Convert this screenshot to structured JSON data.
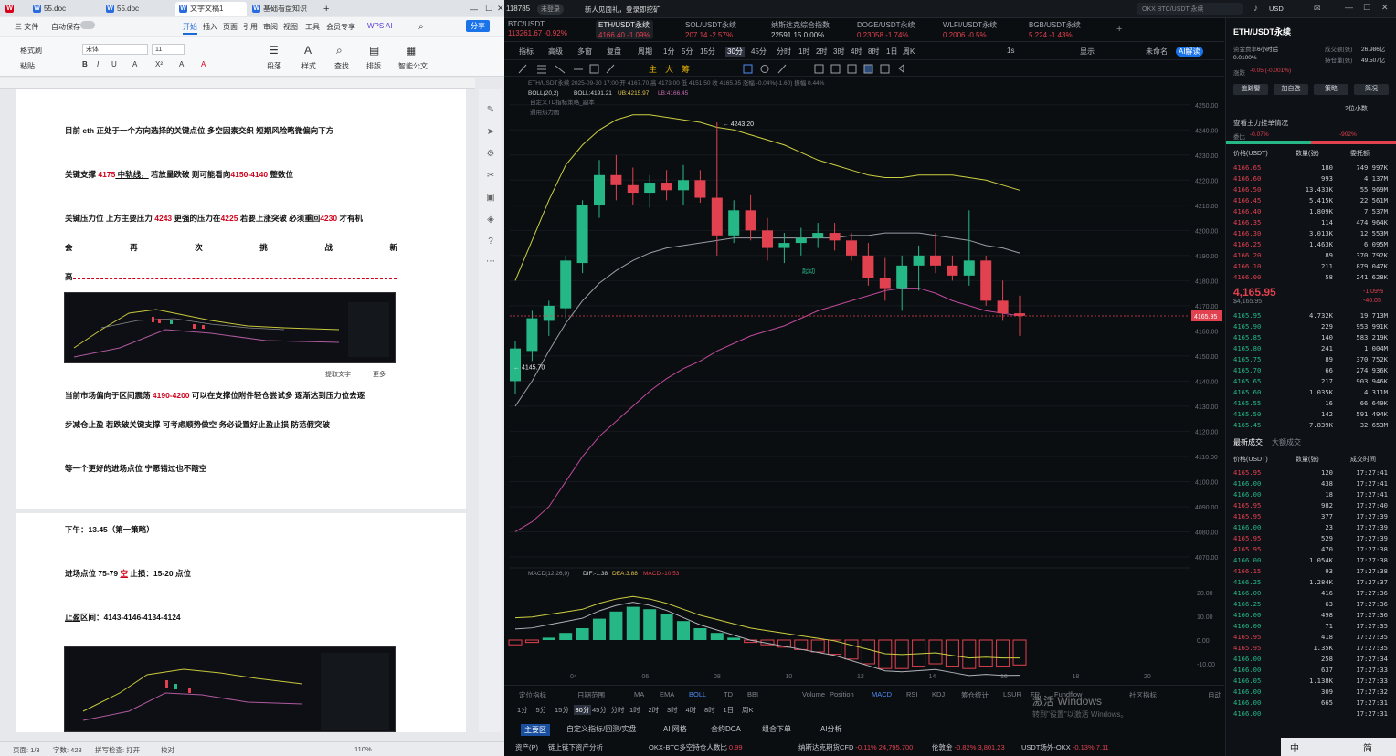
{
  "wps": {
    "tabs": [
      {
        "label": "WPS",
        "icon": "wps-logo-icon",
        "color": "#d9001b"
      },
      {
        "label": "55.doc",
        "icon": "doc-icon",
        "color": "#2b6be0"
      },
      {
        "label": "55.doc",
        "icon": "doc-icon",
        "color": "#2b6be0"
      },
      {
        "label": "文字文稿1",
        "icon": "doc-icon",
        "color": "#2b6be0"
      },
      {
        "label": "基础看盘知识",
        "icon": "doc-icon",
        "color": "#2b6be0"
      }
    ],
    "menu": [
      "三 文件",
      "自动保存",
      "开始",
      "插入",
      "页面",
      "引用",
      "审阅",
      "视图",
      "工具",
      "会员专享",
      "WPS AI"
    ],
    "share_label": "分享",
    "ribbon": {
      "format_painter": "格式刷",
      "paste": "粘贴",
      "font": "宋体",
      "font_size": "11",
      "paragraph": "段落",
      "styles": "样式",
      "find": "查找",
      "layout": "排版",
      "smart": "智能公文"
    },
    "doc": {
      "line1": "目前 eth 正处于一个方向选择的关键点位  多空因素交织  短期风险略微偏向下方",
      "support_pre": "关键支撑",
      "support_val": "4175",
      "support_mid": " 中轨线，",
      "support_rest": " 若放量跌破  则可能看向",
      "support_target": "4150-4140",
      "support_end": " 整数位",
      "resist_pre": "关键压力位  上方主要压力",
      "resist_val1": "4243",
      "resist_mid": "  更强的压力在",
      "resist_val2": "4225",
      "resist_mid2": "  若要上涨突破  必须重回",
      "resist_val3": "4230",
      "resist_end": "  才有机",
      "spaced": [
        "会",
        "再",
        "次",
        "挑",
        "战",
        "新"
      ],
      "gao": "高",
      "extract": "提取文字",
      "more": "更多",
      "market_pre": "当前市场偏向于区间震荡",
      "market_range": "4190-4200",
      "market_rest": " 可以在支撑位附件轻仓尝试多  逐渐达到压力位去逐",
      "step_line": "步减仓止盈  若跌破关键支撑  可考虑顺势做空  务必设置好止盈止损  防范假突破",
      "wait_line": "等一个更好的进场点位  宁愿错过也不瞎空",
      "afternoon": "下午：13.45（第一策略）",
      "entry_pre": "进场点位 75-79 ",
      "entry_side": "空",
      "entry_sl": "  止损：15-20 点位",
      "tp_pre": "止盈",
      "tp_rest": "区间：4143-4146-4134-4124"
    },
    "status": {
      "page": "页面: 1/3",
      "words": "字数: 428",
      "spell": "拼写检查: 打开",
      "proof": "校对",
      "zoom": "110%"
    }
  },
  "okx": {
    "top": {
      "counter": "118785",
      "badge": "未登录",
      "notice": "新人见面礼，登录即挖矿",
      "search": "OKX BTC/USDT 永续",
      "currency": "USD"
    },
    "tickers": [
      {
        "name": "BTC/USDT",
        "price": "113261.67",
        "chg": "-0.92%"
      },
      {
        "name": "ETH/USDT永续",
        "price": "4166.40",
        "chg": "-1.09%"
      },
      {
        "name": "SOL/USDT永续",
        "price": "207.14",
        "chg": "-2.57%"
      },
      {
        "name": "纳斯达克综合指数",
        "price": "22591.15",
        "chg": "0.00%"
      },
      {
        "name": "DOGE/USDT永续",
        "price": "0.23058",
        "chg": "-1.74%"
      },
      {
        "name": "WLFI/USDT永续",
        "price": "0.2006",
        "chg": "-0.5%"
      },
      {
        "name": "BGB/USDT永续",
        "price": "5.224",
        "chg": "-1.43%"
      }
    ],
    "toolbar": [
      "指标",
      "高级",
      "多窗",
      "复盘",
      "周期",
      "1分",
      "5分",
      "15分",
      "30分",
      "45分",
      "分时",
      "1时",
      "2时",
      "3时",
      "4时",
      "8时",
      "1日",
      "周K"
    ],
    "toolbar_right": [
      "1s",
      "显示",
      "未命名",
      "AI解读"
    ],
    "chart": {
      "info": "ETH/USDT永续 2025-09-30 17:00 开 4167.70 高 4173.00 低 4151.50 收 4165.95 涨幅 -0.04%(-1.60) 振幅 0.44%",
      "boll": "BOLL(20,2)",
      "boll_mb": "BOLL:4191.21",
      "boll_ub": "UB:4215.97",
      "boll_lb": "LB:4166.45",
      "sub1": "自定义TD指标策略_副本",
      "sub2": "通用热力图",
      "high_label": "4243.20",
      "low_label": "4145.70",
      "buy_label": "起动",
      "current_price": "4165.95",
      "price_ticks": [
        "4250.00",
        "4240.00",
        "4230.00",
        "4220.00",
        "4210.00",
        "4200.00",
        "4190.00",
        "4180.00",
        "4170.00",
        "4160.00",
        "4150.00",
        "4140.00",
        "4130.00",
        "4120.00",
        "4110.00",
        "4100.00",
        "4090.00",
        "4080.00",
        "4070.00"
      ],
      "x_ticks": [
        "04",
        "06",
        "08",
        "10",
        "12",
        "14",
        "16",
        "18",
        "20"
      ],
      "macd_label": "MACD(12,26,9)",
      "macd_dif": "DIF:-1.38",
      "macd_dea": "DEA:3.88",
      "macd_val": "MACD:-10.53",
      "macd_ticks": [
        "20.00",
        "10.00",
        "0.00",
        "-10.00"
      ]
    },
    "chart_data": {
      "type": "candlestick",
      "title": "ETH/USDT永续 30分",
      "ohlc": [
        [
          4140,
          4156,
          4135,
          4153
        ],
        [
          4152,
          4168,
          4148,
          4165
        ],
        [
          4164,
          4172,
          4158,
          4170
        ],
        [
          4169,
          4190,
          4165,
          4188
        ],
        [
          4187,
          4212,
          4183,
          4210
        ],
        [
          4210,
          4228,
          4205,
          4222
        ],
        [
          4222,
          4230,
          4212,
          4218
        ],
        [
          4218,
          4225,
          4210,
          4215
        ],
        [
          4215,
          4222,
          4209,
          4219
        ],
        [
          4219,
          4224,
          4212,
          4216
        ],
        [
          4216,
          4226,
          4210,
          4220
        ],
        [
          4220,
          4224,
          4211,
          4213
        ],
        [
          4213,
          4243,
          4190,
          4198
        ],
        [
          4198,
          4212,
          4195,
          4208
        ],
        [
          4208,
          4214,
          4196,
          4200
        ],
        [
          4200,
          4205,
          4188,
          4193
        ],
        [
          4193,
          4199,
          4187,
          4195
        ],
        [
          4195,
          4201,
          4190,
          4197
        ],
        [
          4197,
          4203,
          4193,
          4199
        ],
        [
          4199,
          4203,
          4192,
          4196
        ],
        [
          4196,
          4199,
          4188,
          4190
        ],
        [
          4190,
          4195,
          4178,
          4181
        ],
        [
          4181,
          4189,
          4172,
          4177
        ],
        [
          4177,
          4190,
          4168,
          4186
        ],
        [
          4186,
          4194,
          4176,
          4190
        ],
        [
          4190,
          4199,
          4183,
          4186
        ],
        [
          4186,
          4190,
          4180,
          4182
        ],
        [
          4182,
          4208,
          4178,
          4188
        ],
        [
          4188,
          4190,
          4170,
          4172
        ],
        [
          4172,
          4180,
          4164,
          4167
        ],
        [
          4167,
          4174,
          4158,
          4166
        ]
      ],
      "boll_upper": [
        4180,
        4196,
        4212,
        4226,
        4234,
        4240,
        4244,
        4246,
        4246,
        4245,
        4244,
        4243,
        4241,
        4240,
        4238,
        4236,
        4234,
        4231,
        4228,
        4226,
        4224,
        4222,
        4221,
        4221,
        4222,
        4222,
        4222,
        4221,
        4220,
        4218,
        4216
      ],
      "boll_mid": [
        4130,
        4140,
        4152,
        4163,
        4172,
        4179,
        4184,
        4188,
        4191,
        4193,
        4194,
        4195,
        4196,
        4197,
        4197,
        4197,
        4197,
        4197,
        4197,
        4197,
        4198,
        4198,
        4199,
        4199,
        4199,
        4198,
        4197,
        4196,
        4194,
        4193,
        4191
      ],
      "boll_lower": [
        4080,
        4084,
        4090,
        4100,
        4110,
        4118,
        4124,
        4130,
        4136,
        4141,
        4145,
        4148,
        4152,
        4155,
        4158,
        4160,
        4162,
        4165,
        4168,
        4170,
        4172,
        4174,
        4176,
        4177,
        4177,
        4175,
        4172,
        4170,
        4168,
        4167,
        4166
      ],
      "macd_hist": [
        -2,
        -1,
        1,
        3,
        5,
        9,
        12,
        14,
        13,
        11,
        8,
        5,
        3,
        1,
        -1,
        -2,
        -3,
        -4,
        -5,
        -6,
        -8,
        -10,
        -12,
        -12,
        -11,
        -10,
        -11,
        -12,
        -11,
        -11,
        -10.5
      ],
      "ylim": [
        4070,
        4255
      ]
    },
    "indicators": [
      "定位指标",
      "日期范围",
      "MA",
      "EMA",
      "BOLL",
      "TD",
      "BBI",
      "Volume",
      "Position",
      "MACD",
      "RSI",
      "KDJ",
      "筹仓统计",
      "LSUR",
      "FR",
      "Fundflow",
      "社区指标",
      "自动"
    ],
    "intervals_bottom": [
      "1分",
      "5分",
      "15分",
      "30分",
      "45分",
      "分时",
      "1时",
      "2时",
      "3时",
      "4时",
      "8时",
      "1日",
      "周K"
    ],
    "bottom_tabs": [
      "主要区",
      "自定义指标/回测/实盘",
      "AI 网格",
      "合约DCA",
      "组合下单",
      "AI分析"
    ],
    "ticker_bar": [
      {
        "name": "资产(P)",
        "val": ""
      },
      {
        "name": "链上链下资产分析",
        "val": ""
      },
      {
        "name": "OKX-BTC多空持仓人数比",
        "val": "0.99"
      },
      {
        "name": "纳斯达克期货CFD",
        "val": "-0.11%  24,795.700"
      },
      {
        "name": "伦敦金",
        "val": "-0.82%  3,801.23"
      },
      {
        "name": "USDT场外-OKX",
        "val": "-0.13%  7.11"
      }
    ],
    "right": {
      "title": "ETH/USDT永续",
      "funding_label": "资金费率",
      "funding_val": "0.0100%",
      "countdown": "6小时后",
      "vol_label": "成交额(张)",
      "vol_val": "26.986亿",
      "oi_label": "持仓量(张)",
      "oi_val": "49.507亿",
      "chg_label": "涨跌",
      "chg_val": "-0.05 (-0.001%)",
      "buttons": [
        "追踪警",
        "加自选",
        "策略",
        "简况"
      ],
      "depth": "2位小数",
      "orderbook_title": "查看主力挂单情况",
      "ratio_label": "委比",
      "ratio_val": "-0.07%",
      "ratio_val2": "-902%",
      "headers": [
        "价格(USDT)",
        "数量(张)",
        "委托额"
      ],
      "asks": [
        [
          "4166.65",
          "180",
          "749.997K"
        ],
        [
          "4166.60",
          "993",
          "4.137M"
        ],
        [
          "4166.50",
          "13.433K",
          "55.969M"
        ],
        [
          "4166.45",
          "5.415K",
          "22.561M"
        ],
        [
          "4166.40",
          "1.809K",
          "7.537M"
        ],
        [
          "4166.35",
          "114",
          "474.964K"
        ],
        [
          "4166.30",
          "3.013K",
          "12.553M"
        ],
        [
          "4166.25",
          "1.463K",
          "6.095M"
        ],
        [
          "4166.20",
          "89",
          "370.792K"
        ],
        [
          "4166.10",
          "211",
          "879.047K"
        ],
        [
          "4166.00",
          "58",
          "241.628K"
        ]
      ],
      "mid_price": "4,165.95",
      "mid_sub": "$4,165.95",
      "mid_pct": "-1.09%",
      "mid_abs": "-46.05",
      "bids": [
        [
          "4165.95",
          "4.732K",
          "19.713M"
        ],
        [
          "4165.90",
          "229",
          "953.991K"
        ],
        [
          "4165.85",
          "140",
          "583.219K"
        ],
        [
          "4165.80",
          "241",
          "1.004M"
        ],
        [
          "4165.75",
          "89",
          "370.752K"
        ],
        [
          "4165.70",
          "66",
          "274.936K"
        ],
        [
          "4165.65",
          "217",
          "903.946K"
        ],
        [
          "4165.60",
          "1.035K",
          "4.311M"
        ],
        [
          "4165.55",
          "16",
          "66.649K"
        ],
        [
          "4165.50",
          "142",
          "591.494K"
        ],
        [
          "4165.45",
          "7.839K",
          "32.653M"
        ]
      ],
      "trades_tabs": [
        "最新成交",
        "大额成交"
      ],
      "trades_headers": [
        "价格(USDT)",
        "数量(张)",
        "成交时间"
      ],
      "trades": [
        [
          "4165.95",
          "120",
          "17:27:41",
          "r"
        ],
        [
          "4166.00",
          "438",
          "17:27:41",
          "g"
        ],
        [
          "4166.00",
          "18",
          "17:27:41",
          "g"
        ],
        [
          "4165.95",
          "982",
          "17:27:40",
          "r"
        ],
        [
          "4165.95",
          "377",
          "17:27:39",
          "r"
        ],
        [
          "4166.00",
          "23",
          "17:27:39",
          "g"
        ],
        [
          "4165.95",
          "529",
          "17:27:39",
          "r"
        ],
        [
          "4165.95",
          "470",
          "17:27:38",
          "r"
        ],
        [
          "4166.00",
          "1.054K",
          "17:27:38",
          "g"
        ],
        [
          "4166.15",
          "93",
          "17:27:38",
          "r"
        ],
        [
          "4166.25",
          "1.284K",
          "17:27:37",
          "g"
        ],
        [
          "4166.00",
          "416",
          "17:27:36",
          "g"
        ],
        [
          "4166.25",
          "63",
          "17:27:36",
          "g"
        ],
        [
          "4166.00",
          "498",
          "17:27:36",
          "g"
        ],
        [
          "4166.00",
          "71",
          "17:27:35",
          "g"
        ],
        [
          "4165.95",
          "418",
          "17:27:35",
          "r"
        ],
        [
          "4165.95",
          "1.35K",
          "17:27:35",
          "r"
        ],
        [
          "4166.00",
          "258",
          "17:27:34",
          "g"
        ],
        [
          "4166.00",
          "637",
          "17:27:33",
          "g"
        ],
        [
          "4166.05",
          "1.138K",
          "17:27:33",
          "g"
        ],
        [
          "4166.00",
          "309",
          "17:27:32",
          "g"
        ],
        [
          "4166.00",
          "665",
          "17:27:31",
          "g"
        ],
        [
          "4166.00",
          "",
          "17:27:31",
          "g"
        ]
      ]
    },
    "watermark1": "激活 Windows",
    "watermark2": "转到\"设置\"以激活 Windows。",
    "taskbar": [
      "中",
      "简"
    ]
  }
}
